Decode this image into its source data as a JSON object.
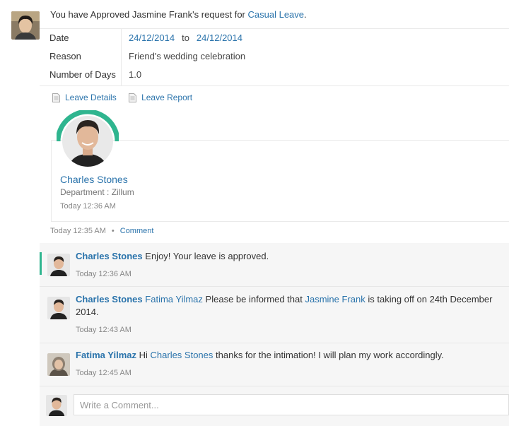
{
  "notification": {
    "prefix": "You have Approved Jasmine Frank's request for",
    "leave_type": "Casual Leave",
    "suffix": "."
  },
  "details": {
    "date_label": "Date",
    "date_from": "24/12/2014",
    "date_to_word": "to",
    "date_to": "24/12/2014",
    "reason_label": "Reason",
    "reason_value": "Friend's wedding celebration",
    "days_label": "Number of Days",
    "days_value": "1.0"
  },
  "actions": {
    "leave_details": "Leave Details",
    "leave_report": "Leave Report"
  },
  "profile": {
    "name": "Charles Stones",
    "department": "Department : Zillum",
    "time": "Today 12:36 AM",
    "ring_color": "#2fb58f"
  },
  "meta": {
    "time": "Today 12:35 AM",
    "comment_link": "Comment"
  },
  "comments": [
    {
      "author": "Charles Stones",
      "text": "Enjoy! Your leave is approved.",
      "time": "Today 12:36 AM"
    },
    {
      "author": "Charles Stones",
      "mention1": "Fatima Yilmaz",
      "text1": "Please be informed that",
      "mention2": "Jasmine Frank",
      "text2": "is taking off on 24th December 2014.",
      "time": "Today 12:43 AM"
    },
    {
      "author": "Fatima Yilmaz",
      "text1": "Hi",
      "mention1": "Charles Stones",
      "text2": "thanks for the intimation! I will plan my work accordingly.",
      "time": "Today 12:45 AM"
    }
  ],
  "composer": {
    "placeholder": "Write a Comment..."
  }
}
